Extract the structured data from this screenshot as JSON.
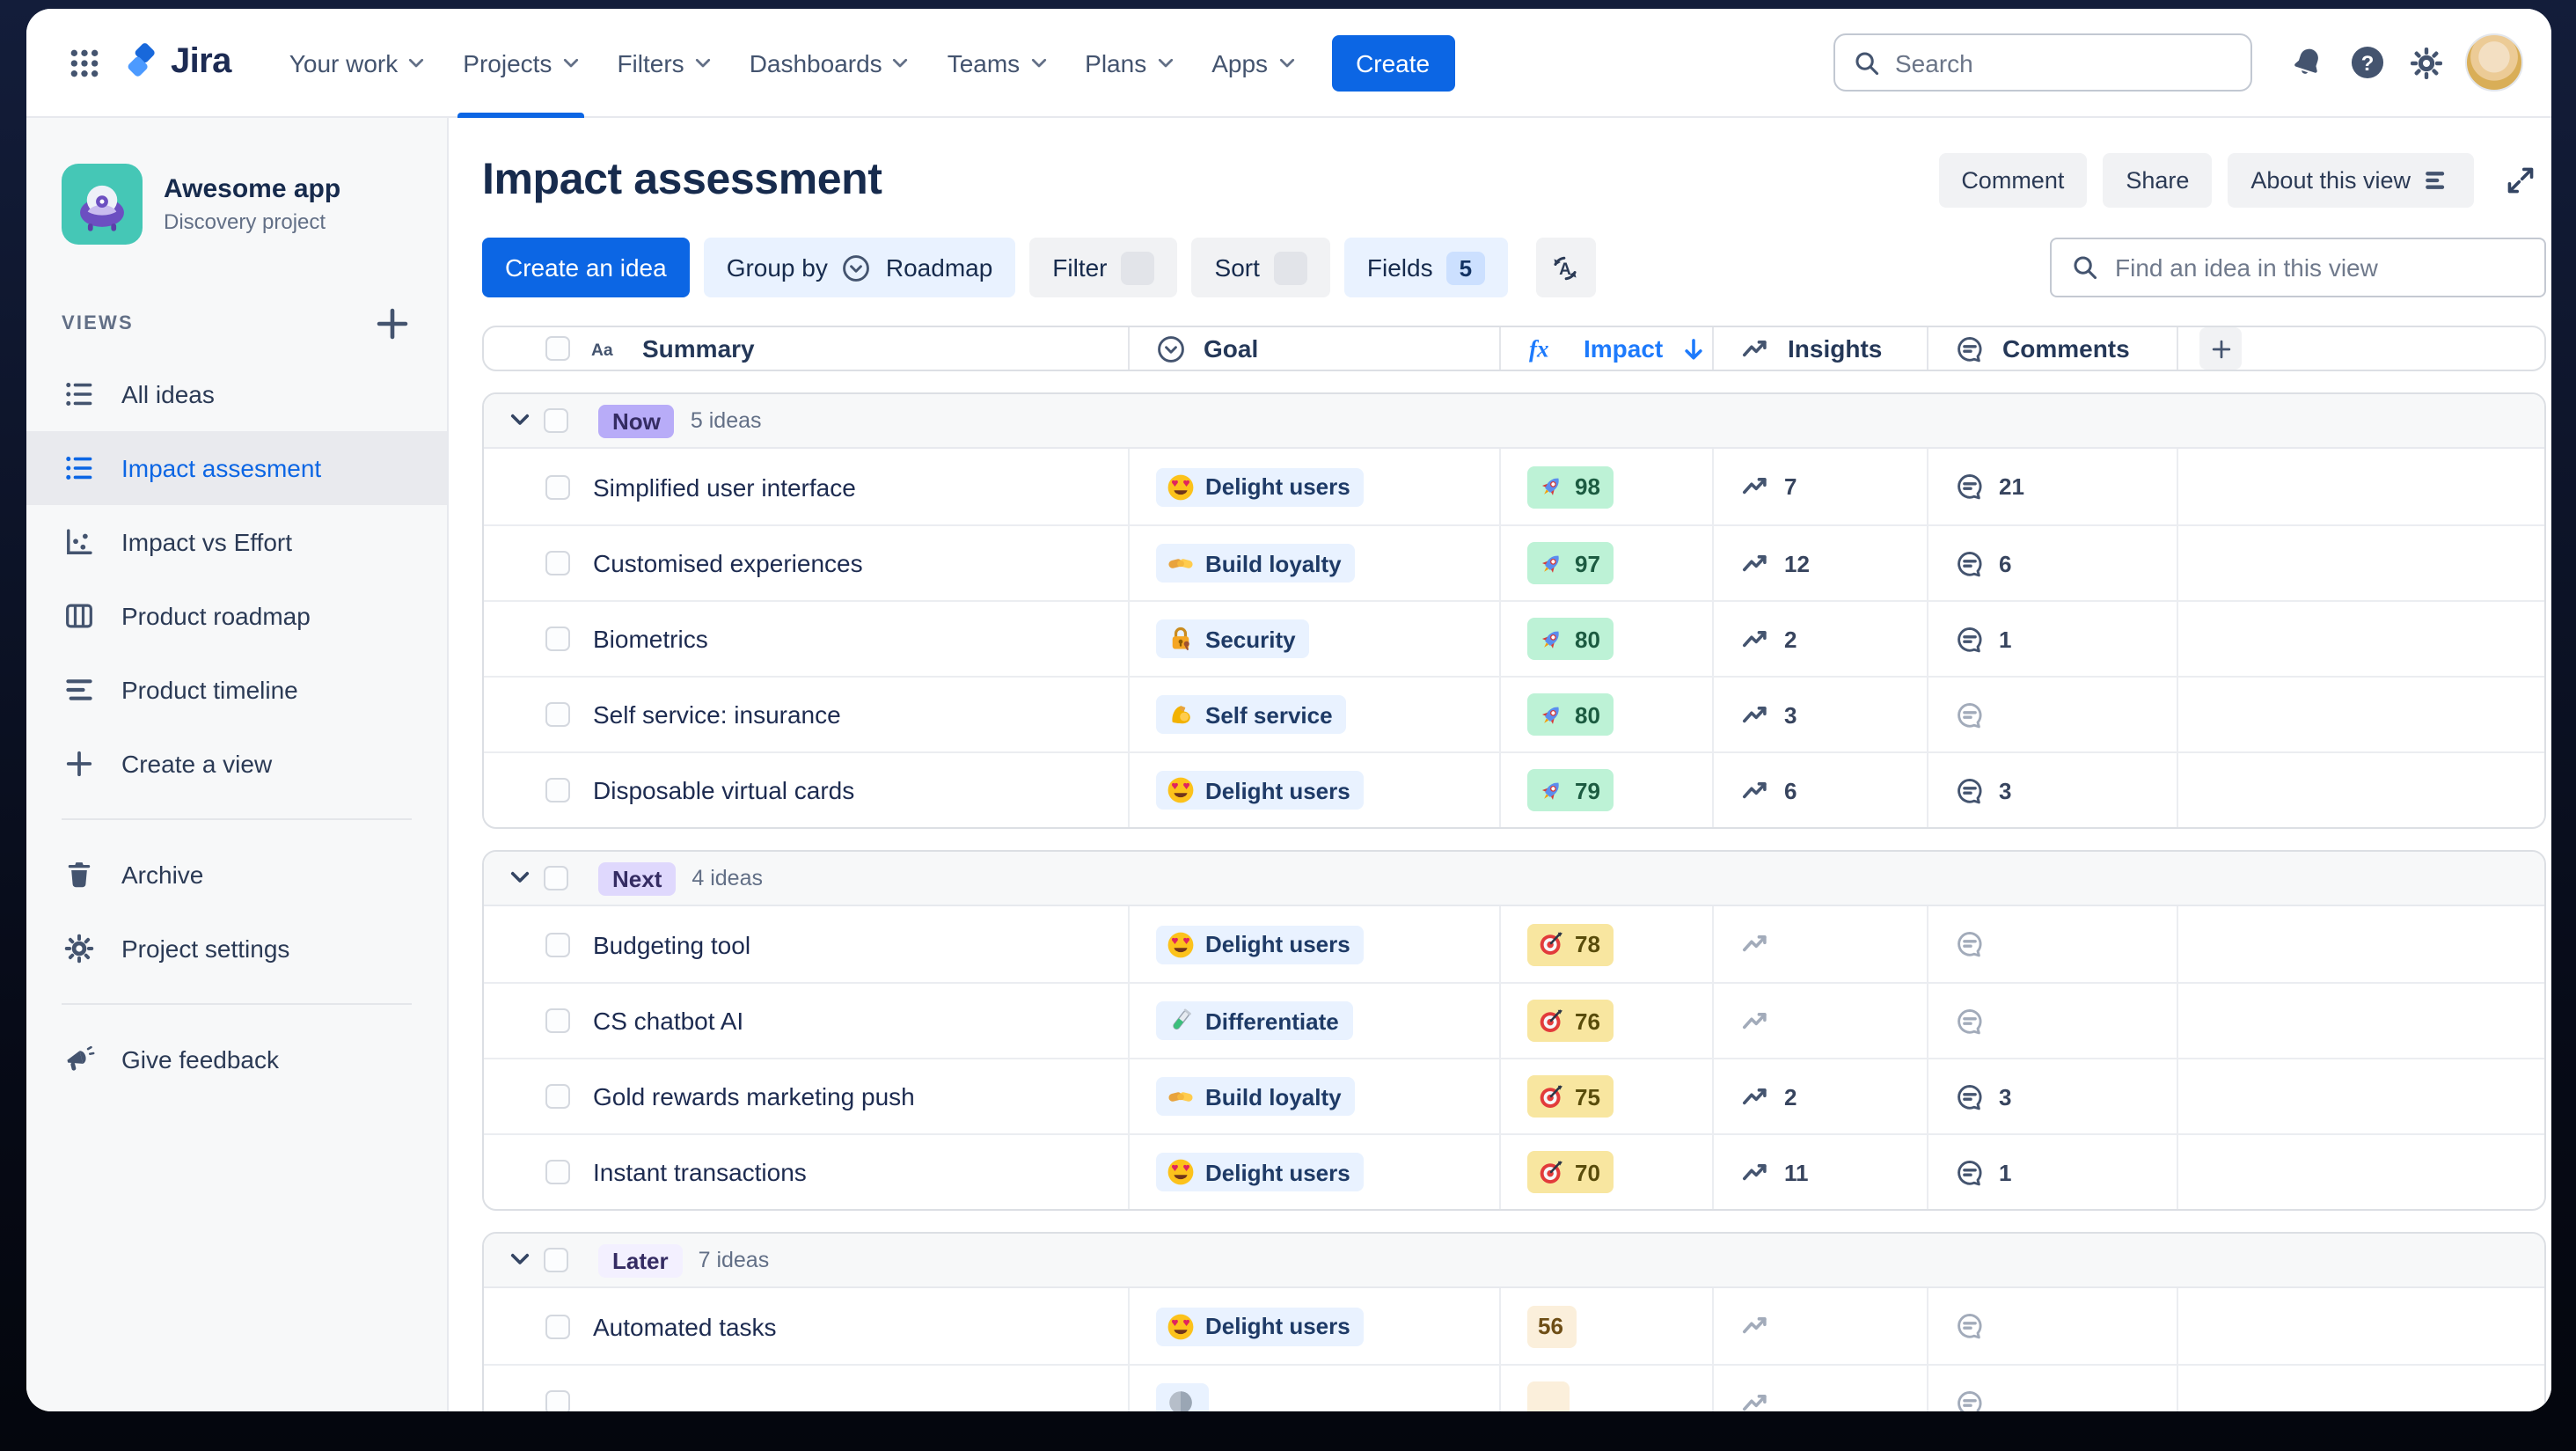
{
  "top_nav": {
    "menu": [
      {
        "label": "Your work",
        "active": false
      },
      {
        "label": "Projects",
        "active": true
      },
      {
        "label": "Filters",
        "active": false
      },
      {
        "label": "Dashboards",
        "active": false
      },
      {
        "label": "Teams",
        "active": false
      },
      {
        "label": "Plans",
        "active": false
      },
      {
        "label": "Apps",
        "active": false
      }
    ],
    "logo_text": "Jira",
    "create_label": "Create",
    "search_placeholder": "Search"
  },
  "sidebar": {
    "project_name": "Awesome app",
    "project_type": "Discovery project",
    "views_label": "VIEWS",
    "items": [
      {
        "label": "All ideas",
        "icon": "list",
        "selected": false
      },
      {
        "label": "Impact assesment",
        "icon": "list",
        "selected": true
      },
      {
        "label": "Impact vs Effort",
        "icon": "scatter",
        "selected": false
      },
      {
        "label": "Product roadmap",
        "icon": "columns",
        "selected": false
      },
      {
        "label": "Product timeline",
        "icon": "timeline",
        "selected": false
      },
      {
        "label": "Create a view",
        "icon": "plus",
        "selected": false
      }
    ],
    "footer_items": [
      {
        "label": "Archive",
        "icon": "trash"
      },
      {
        "label": "Project settings",
        "icon": "gear"
      }
    ],
    "feedback_label": "Give feedback"
  },
  "header": {
    "title": "Impact assessment",
    "comment_label": "Comment",
    "share_label": "Share",
    "about_label": "About this view"
  },
  "toolbar": {
    "create_idea_label": "Create an idea",
    "group_by_label": "Group by",
    "group_by_value": "Roadmap",
    "filter_label": "Filter",
    "sort_label": "Sort",
    "fields_label": "Fields",
    "fields_count": "5",
    "find_placeholder": "Find an idea in this view"
  },
  "table": {
    "columns": [
      {
        "label": "Summary"
      },
      {
        "label": "Goal"
      },
      {
        "label": "Impact",
        "sorted": "desc"
      },
      {
        "label": "Insights"
      },
      {
        "label": "Comments"
      }
    ],
    "groups": [
      {
        "label": "Now",
        "count_text": "5 ideas",
        "badge_bg": "#B8ACF8",
        "rows": [
          {
            "summary": "Simplified user interface",
            "goal": {
              "emoji": "heart-eyes",
              "label": "Delight users"
            },
            "impact": {
              "value": "98",
              "tone": "green",
              "emoji": "rocket"
            },
            "insights": "7",
            "comments": "21"
          },
          {
            "summary": "Customised experiences",
            "goal": {
              "emoji": "handshake",
              "label": "Build loyalty"
            },
            "impact": {
              "value": "97",
              "tone": "green",
              "emoji": "rocket"
            },
            "insights": "12",
            "comments": "6"
          },
          {
            "summary": "Biometrics",
            "goal": {
              "emoji": "lock",
              "label": "Security"
            },
            "impact": {
              "value": "80",
              "tone": "green",
              "emoji": "rocket"
            },
            "insights": "2",
            "comments": "1"
          },
          {
            "summary": "Self service: insurance",
            "goal": {
              "emoji": "biceps",
              "label": "Self service"
            },
            "impact": {
              "value": "80",
              "tone": "green",
              "emoji": "rocket"
            },
            "insights": "3",
            "comments": null
          },
          {
            "summary": "Disposable virtual cards",
            "goal": {
              "emoji": "heart-eyes",
              "label": "Delight users"
            },
            "impact": {
              "value": "79",
              "tone": "green",
              "emoji": "rocket"
            },
            "insights": "6",
            "comments": "3"
          }
        ]
      },
      {
        "label": "Next",
        "count_text": "4 ideas",
        "badge_bg": "#DFD8FD",
        "rows": [
          {
            "summary": "Budgeting tool",
            "goal": {
              "emoji": "heart-eyes",
              "label": "Delight users"
            },
            "impact": {
              "value": "78",
              "tone": "yellow",
              "emoji": "target"
            },
            "insights": null,
            "comments": null
          },
          {
            "summary": "CS chatbot AI",
            "goal": {
              "emoji": "test-tube",
              "label": "Differentiate"
            },
            "impact": {
              "value": "76",
              "tone": "yellow",
              "emoji": "target"
            },
            "insights": null,
            "comments": null
          },
          {
            "summary": "Gold rewards marketing push",
            "goal": {
              "emoji": "handshake",
              "label": "Build loyalty"
            },
            "impact": {
              "value": "75",
              "tone": "yellow",
              "emoji": "target"
            },
            "insights": "2",
            "comments": "3"
          },
          {
            "summary": "Instant transactions",
            "goal": {
              "emoji": "heart-eyes",
              "label": "Delight users"
            },
            "impact": {
              "value": "70",
              "tone": "yellow",
              "emoji": "target"
            },
            "insights": "11",
            "comments": "1"
          }
        ]
      },
      {
        "label": "Later",
        "count_text": "7 ideas",
        "badge_bg": "#F3F0FF",
        "rows": [
          {
            "summary": "Automated tasks",
            "goal": {
              "emoji": "heart-eyes",
              "label": "Delight users"
            },
            "impact": {
              "value": "56",
              "tone": "amber",
              "emoji": ""
            },
            "insights": null,
            "comments": null
          },
          {
            "summary": "",
            "partial": true,
            "goal": {
              "emoji": "unknown",
              "label": ""
            },
            "impact": {
              "value": "",
              "tone": "amber",
              "emoji": ""
            },
            "insights": null,
            "comments": null
          }
        ]
      }
    ]
  },
  "colors": {
    "accent_blue": "#0C66E4",
    "sorted_column_blue": "#1D7AFC",
    "goal_badge_bg": "#E9F2FF",
    "impact_green_bg": "#BDF2D6",
    "impact_yellow_bg": "#F8E6A0",
    "impact_amber_bg": "#FBEFDB",
    "group_now_bg": "#B8ACF8",
    "group_next_bg": "#DFD8FD",
    "group_later_bg": "#F3F0FF"
  }
}
